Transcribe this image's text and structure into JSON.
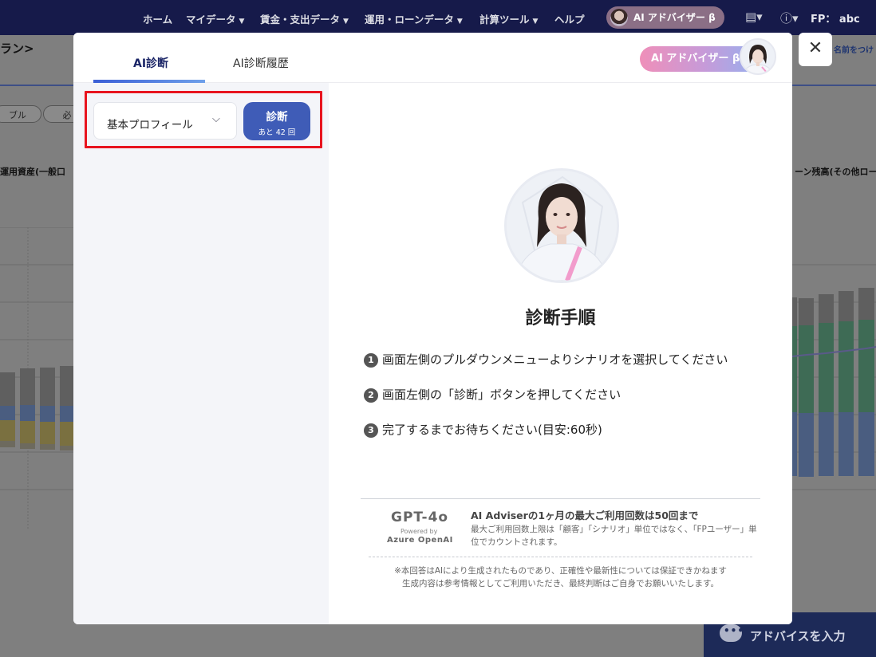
{
  "nav": {
    "items": [
      {
        "label": "ホーム",
        "caret": false
      },
      {
        "label": "マイデータ",
        "caret": true
      },
      {
        "label": "賃金・支出データ",
        "caret": true
      },
      {
        "label": "運用・ローンデータ",
        "caret": true
      },
      {
        "label": "計算ツール",
        "caret": true
      },
      {
        "label": "ヘルプ",
        "caret": false
      }
    ],
    "ai_button": "AI アドバイザー β",
    "user": "FP： abc"
  },
  "background": {
    "page_title": "ラン>",
    "pill_1": "ブル",
    "pill_2": "必",
    "label_left": "運用資産(一般口",
    "label_right": "ーン残高(その他ロー",
    "name_button": "名前をつけ",
    "advice_button": "アドバイスを入力"
  },
  "modal": {
    "tabs": [
      {
        "label": "AI診断",
        "active": true
      },
      {
        "label": "AI診断履歴",
        "active": false
      }
    ],
    "advisor_pill": "AI アドバイザー β",
    "scenario_select": {
      "value": "基本プロフィール"
    },
    "diagnose_button": {
      "label": "診断",
      "remaining": "あと 42 回"
    },
    "steps_title": "診断手順",
    "steps": [
      {
        "num": "1",
        "text": "画面左側のプルダウンメニューよりシナリオを選択してください"
      },
      {
        "num": "2",
        "text": "画面左側の「診断」ボタンを押してください"
      },
      {
        "num": "3",
        "text": "完了するまでお待ちください(目安:60秒)"
      }
    ],
    "footer": {
      "model_name": "GPT-4o",
      "powered_by": "Powered by",
      "provider": "Azure OpenAI",
      "limit_title": "AI Adviserの1ヶ月の最大ご利用回数は50回まで",
      "limit_note": "最大ご利用回数上限は「顧客」「シナリオ」単位ではなく、「FPユーザー」単位でカウントされます。",
      "disclaimer_1": "※本回答はAIにより生成されたものであり、正確性や最新性については保証できかねます",
      "disclaimer_2": "生成内容は参考情報としてご利用いただき、最終判断はご自身でお願いいたします。"
    }
  },
  "colors": {
    "nav_bg": "#161a4a",
    "primary_button": "#3f5cb7",
    "highlight_border": "#e8141f",
    "tab_active": "#1a2466"
  }
}
